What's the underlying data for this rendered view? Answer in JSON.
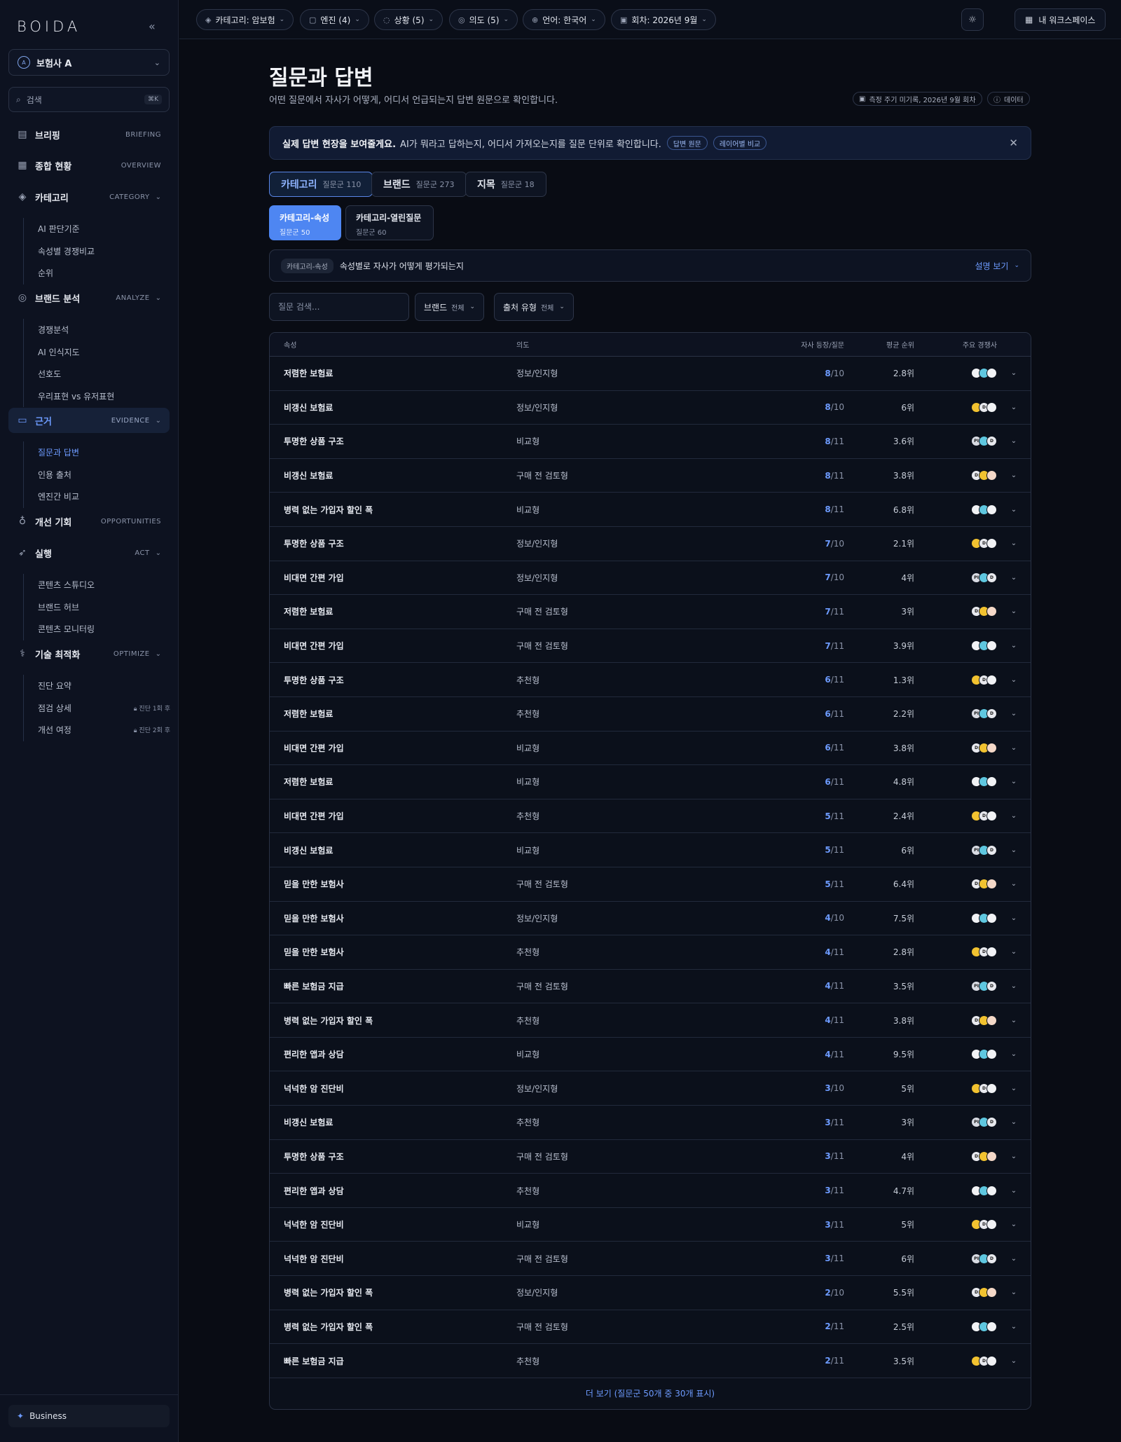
{
  "sidebar": {
    "logo": "BOIDA",
    "org": {
      "name": "보험사 A",
      "badge": "A"
    },
    "search": {
      "label": "검색",
      "shortcut": "⌘K"
    },
    "nav": [
      {
        "label": "브리핑",
        "en": "BRIEFING",
        "icon": "document-icon",
        "children": []
      },
      {
        "label": "종합 현황",
        "en": "OVERVIEW",
        "icon": "grid-icon",
        "children": []
      },
      {
        "label": "카테고리",
        "en": "CATEGORY",
        "icon": "layers-icon",
        "children": [
          "AI 판단기준",
          "속성별 경쟁비교",
          "순위"
        ]
      },
      {
        "label": "브랜드 분석",
        "en": "ANALYZE",
        "icon": "target-icon",
        "children": [
          "경쟁분석",
          "AI 인식지도",
          "선호도",
          "우리표현 vs 유저표현"
        ]
      },
      {
        "label": "근거",
        "en": "EVIDENCE",
        "icon": "chat-icon",
        "active": true,
        "children": [
          "질문과 답변",
          "인용 출처",
          "엔진간 비교"
        ]
      },
      {
        "label": "개선 기회",
        "en": "OPPORTUNITIES",
        "icon": "bulb-icon",
        "children": []
      },
      {
        "label": "실행",
        "en": "ACT",
        "icon": "rocket-icon",
        "children": [
          "콘텐츠 스튜디오",
          "브랜드 허브",
          "콘텐츠 모니터링"
        ]
      },
      {
        "label": "기술 최적화",
        "en": "OPTIMIZE",
        "icon": "stethoscope-icon",
        "children": [
          "진단 요약",
          "점검 상세",
          "개선 여정"
        ]
      }
    ],
    "locks": {
      "inspect": "진단 1회 후",
      "journey": "진단 2회 후"
    },
    "plan": "Business"
  },
  "topbar": {
    "filters": [
      {
        "label": "카테고리: 암보험",
        "icon": "layers-icon"
      },
      {
        "label": "엔진 (4)",
        "icon": "bot-icon"
      },
      {
        "label": "상황 (5)",
        "icon": "compass-icon"
      },
      {
        "label": "의도 (5)",
        "icon": "target-icon"
      },
      {
        "label": "언어: 한국어",
        "icon": "globe-icon"
      },
      {
        "label": "회차: 2026년 9월",
        "icon": "calendar-icon"
      }
    ],
    "workspace": "내 워크스페이스"
  },
  "page": {
    "title": "질문과 답변",
    "subtitle": "어떤 질문에서 자사가 어떻게, 어디서 언급되는지 답변 원문으로 확인합니다.",
    "meta_period": "측정 주기 미기록, 2026년 9월 회차",
    "meta_data": "데이터"
  },
  "banner": {
    "title": "실제 답변 현장을 보여줄게요.",
    "desc": "AI가 뭐라고 답하는지, 어디서 가져오는지를 질문 단위로 확인합니다.",
    "pill1": "답변 원문",
    "pill2": "레이어별 비교"
  },
  "tabs": [
    {
      "label": "카테고리",
      "count": "질문군 110"
    },
    {
      "label": "브랜드",
      "count": "질문군 273"
    },
    {
      "label": "지목",
      "count": "질문군 18"
    }
  ],
  "subtabs": [
    {
      "label": "카테고리-속성",
      "count": "질문군 50"
    },
    {
      "label": "카테고리-열린질문",
      "count": "질문군 60"
    }
  ],
  "info": {
    "badge": "카테고리-속성",
    "text": "속성별로 자사가 어떻게 평가되는지",
    "link": "설명 보기"
  },
  "filters": {
    "search_placeholder": "질문 검색...",
    "brand_label": "브랜드",
    "brand_value": "전체",
    "source_label": "출처 유형",
    "source_value": "전체"
  },
  "table": {
    "headers": [
      "속성",
      "의도",
      "자사 등장/질문",
      "평균 순위",
      "주요 경쟁사"
    ],
    "rows": [
      {
        "attr": "저렴한 보험료",
        "intent": "정보/인지형",
        "hit": "8",
        "total": "/10",
        "rank": "2.8위"
      },
      {
        "attr": "비갱신 보험료",
        "intent": "정보/인지형",
        "hit": "8",
        "total": "/10",
        "rank": "6위"
      },
      {
        "attr": "투명한 상품 구조",
        "intent": "비교형",
        "hit": "8",
        "total": "/11",
        "rank": "3.6위"
      },
      {
        "attr": "비갱신 보험료",
        "intent": "구매 전 검토형",
        "hit": "8",
        "total": "/11",
        "rank": "3.8위"
      },
      {
        "attr": "병력 없는 가입자 할인 폭",
        "intent": "비교형",
        "hit": "8",
        "total": "/11",
        "rank": "6.8위"
      },
      {
        "attr": "투명한 상품 구조",
        "intent": "정보/인지형",
        "hit": "7",
        "total": "/10",
        "rank": "2.1위"
      },
      {
        "attr": "비대면 간편 가입",
        "intent": "정보/인지형",
        "hit": "7",
        "total": "/10",
        "rank": "4위"
      },
      {
        "attr": "저렴한 보험료",
        "intent": "구매 전 검토형",
        "hit": "7",
        "total": "/11",
        "rank": "3위"
      },
      {
        "attr": "비대면 간편 가입",
        "intent": "구매 전 검토형",
        "hit": "7",
        "total": "/11",
        "rank": "3.9위"
      },
      {
        "attr": "투명한 상품 구조",
        "intent": "추천형",
        "hit": "6",
        "total": "/11",
        "rank": "1.3위"
      },
      {
        "attr": "저렴한 보험료",
        "intent": "추천형",
        "hit": "6",
        "total": "/11",
        "rank": "2.2위"
      },
      {
        "attr": "비대면 간편 가입",
        "intent": "비교형",
        "hit": "6",
        "total": "/11",
        "rank": "3.8위"
      },
      {
        "attr": "저렴한 보험료",
        "intent": "비교형",
        "hit": "6",
        "total": "/11",
        "rank": "4.8위"
      },
      {
        "attr": "비대면 간편 가입",
        "intent": "추천형",
        "hit": "5",
        "total": "/11",
        "rank": "2.4위"
      },
      {
        "attr": "비갱신 보험료",
        "intent": "비교형",
        "hit": "5",
        "total": "/11",
        "rank": "6위"
      },
      {
        "attr": "믿을 만한 보험사",
        "intent": "구매 전 검토형",
        "hit": "5",
        "total": "/11",
        "rank": "6.4위"
      },
      {
        "attr": "믿을 만한 보험사",
        "intent": "정보/인지형",
        "hit": "4",
        "total": "/10",
        "rank": "7.5위"
      },
      {
        "attr": "믿을 만한 보험사",
        "intent": "추천형",
        "hit": "4",
        "total": "/11",
        "rank": "2.8위"
      },
      {
        "attr": "빠른 보험금 지급",
        "intent": "구매 전 검토형",
        "hit": "4",
        "total": "/11",
        "rank": "3.5위"
      },
      {
        "attr": "병력 없는 가입자 할인 폭",
        "intent": "추천형",
        "hit": "4",
        "total": "/11",
        "rank": "3.8위"
      },
      {
        "attr": "편리한 앱과 상담",
        "intent": "비교형",
        "hit": "4",
        "total": "/11",
        "rank": "9.5위"
      },
      {
        "attr": "넉넉한 암 진단비",
        "intent": "정보/인지형",
        "hit": "3",
        "total": "/10",
        "rank": "5위"
      },
      {
        "attr": "비갱신 보험료",
        "intent": "추천형",
        "hit": "3",
        "total": "/11",
        "rank": "3위"
      },
      {
        "attr": "투명한 상품 구조",
        "intent": "구매 전 검토형",
        "hit": "3",
        "total": "/11",
        "rank": "4위"
      },
      {
        "attr": "편리한 앱과 상담",
        "intent": "추천형",
        "hit": "3",
        "total": "/11",
        "rank": "4.7위"
      },
      {
        "attr": "넉넉한 암 진단비",
        "intent": "비교형",
        "hit": "3",
        "total": "/11",
        "rank": "5위"
      },
      {
        "attr": "넉넉한 암 진단비",
        "intent": "구매 전 검토형",
        "hit": "3",
        "total": "/11",
        "rank": "6위"
      },
      {
        "attr": "병력 없는 가입자 할인 폭",
        "intent": "정보/인지형",
        "hit": "2",
        "total": "/10",
        "rank": "5.5위"
      },
      {
        "attr": "병력 없는 가입자 할인 폭",
        "intent": "구매 전 검토형",
        "hit": "2",
        "total": "/11",
        "rank": "2.5위"
      },
      {
        "attr": "빠른 보험금 지급",
        "intent": "추천형",
        "hit": "2",
        "total": "/11",
        "rank": "3.5위"
      }
    ],
    "more": "더 보기 (질문군 50개 중 30개 표시)"
  },
  "colors": {
    "accent": "#6d9bff",
    "active_tab": "#4e86f2",
    "avatar_yellow": "#f2c230",
    "avatar_teal": "#5fc7e0",
    "avatar_white": "#f1f2f5"
  }
}
